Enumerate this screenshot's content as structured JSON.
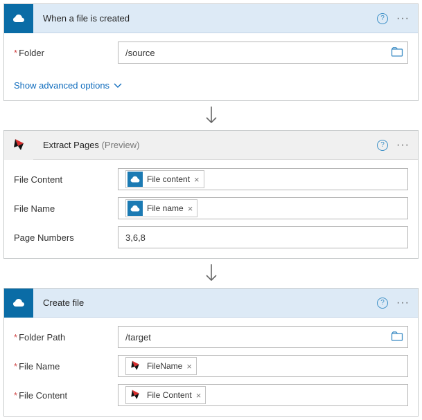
{
  "step1": {
    "title": "When a file is created",
    "folder_label": "Folder",
    "folder_value": "/source",
    "advanced": "Show advanced options"
  },
  "step2": {
    "title": "Extract Pages",
    "preview": "(Preview)",
    "fc_label": "File Content",
    "fc_pill": "File content",
    "fn_label": "File Name",
    "fn_pill": "File name",
    "pn_label": "Page Numbers",
    "pn_value": "3,6,8"
  },
  "step3": {
    "title": "Create file",
    "fp_label": "Folder Path",
    "fp_value": "/target",
    "fn_label": "File Name",
    "fn_pill": "FileName",
    "fc_label": "File Content",
    "fc_pill": "File Content"
  }
}
